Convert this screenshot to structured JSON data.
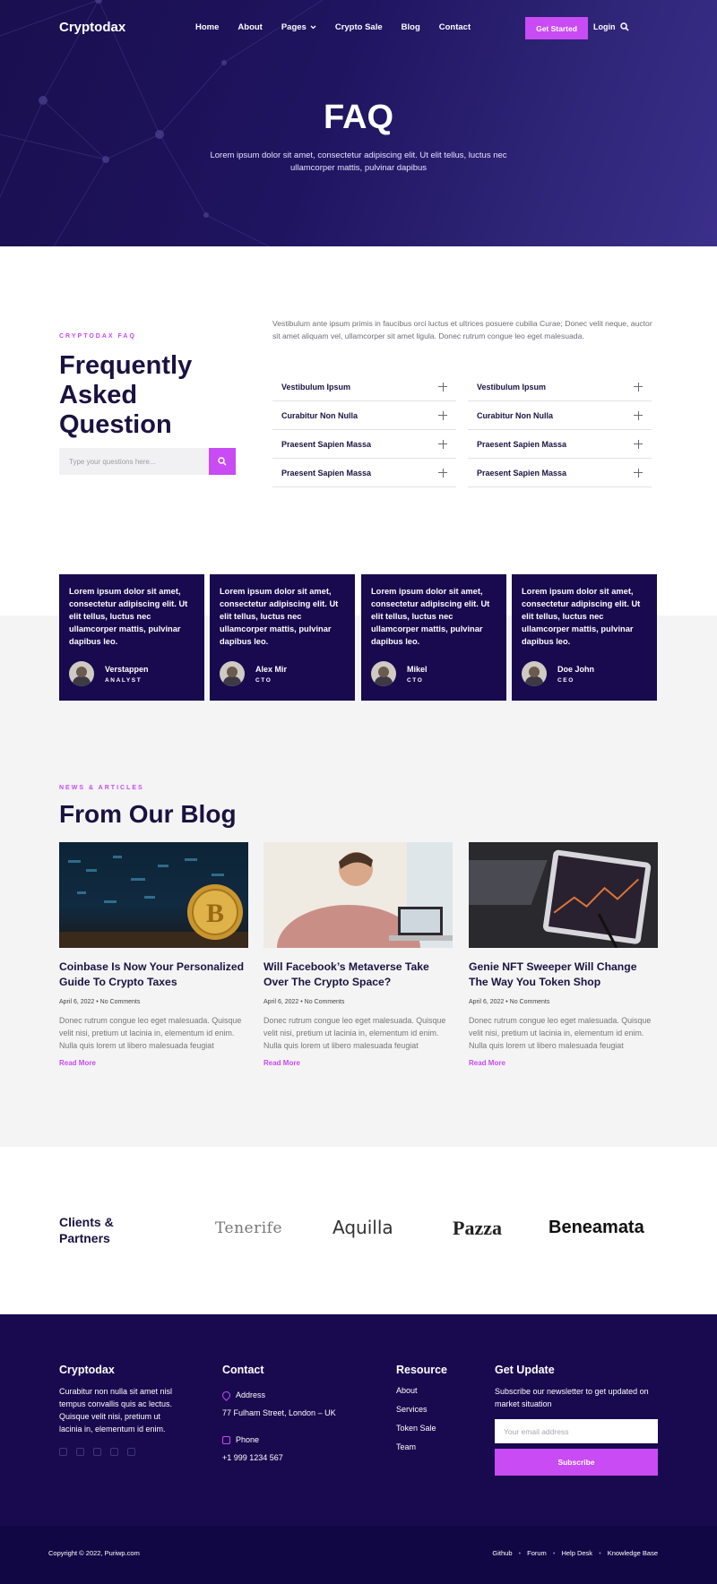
{
  "nav": {
    "logo": "Cryptodax",
    "items": [
      "Home",
      "About",
      "Pages",
      "Crypto Sale",
      "Blog",
      "Contact"
    ],
    "cta": "Get Started",
    "login": "Login"
  },
  "hero": {
    "title": "FAQ",
    "subtitle": "Lorem ipsum dolor sit amet, consectetur adipiscing elit. Ut elit tellus, luctus nec ullamcorper mattis, pulvinar dapibus"
  },
  "faq": {
    "eyebrow": "CRYPTODAX FAQ",
    "title": "Frequently Asked Question",
    "search_placeholder": "Type your questions here...",
    "intro": "Vestibulum ante ipsum primis in faucibus orci luctus et ultrices posuere cubilia Curae; Donec velit neque, auctor sit amet aliquam vel, ullamcorper sit amet ligula. Donec rutrum congue leo eget malesuada.",
    "left": [
      "Vestibulum Ipsum",
      "Curabitur Non Nulla",
      "Praesent Sapien Massa",
      "Praesent Sapien Massa"
    ],
    "right": [
      "Vestibulum Ipsum",
      "Curabitur Non Nulla",
      "Praesent Sapien Massa",
      "Praesent Sapien Massa"
    ]
  },
  "testimonials": [
    {
      "text": "Lorem ipsum dolor sit amet, consectetur adipiscing elit. Ut elit tellus, luctus nec ullamcorper mattis, pulvinar dapibus leo.",
      "name": "Verstappen",
      "role": "ANALYST"
    },
    {
      "text": "Lorem ipsum dolor sit amet, consectetur adipiscing elit. Ut elit tellus, luctus nec ullamcorper mattis, pulvinar dapibus leo.",
      "name": "Alex Mir",
      "role": "CTO"
    },
    {
      "text": "Lorem ipsum dolor sit amet, consectetur adipiscing elit. Ut elit tellus, luctus nec ullamcorper mattis, pulvinar dapibus leo.",
      "name": "Mikel",
      "role": "CTO"
    },
    {
      "text": "Lorem ipsum dolor sit amet, consectetur adipiscing elit. Ut elit tellus, luctus nec ullamcorper mattis, pulvinar dapibus leo.",
      "name": "Doe John",
      "role": "CEO"
    }
  ],
  "blog": {
    "eyebrow": "NEWS & ARTICLES",
    "title": "From Our Blog",
    "posts": [
      {
        "title": "Coinbase Is Now Your Personalized Guide To Crypto Taxes",
        "meta": "April 6, 2022 • No Comments",
        "excerpt": "Donec rutrum congue leo eget malesuada. Quisque velit nisi, pretium ut lacinia in, elementum id enim. Nulla quis lorem ut libero malesuada feugiat",
        "more": "Read More"
      },
      {
        "title": "Will Facebook’s Metaverse Take Over The Crypto Space?",
        "meta": "April 6, 2022 • No Comments",
        "excerpt": "Donec rutrum congue leo eget malesuada. Quisque velit nisi, pretium ut lacinia in, elementum id enim. Nulla quis lorem ut libero malesuada feugiat",
        "more": "Read More"
      },
      {
        "title": "Genie NFT Sweeper Will Change The Way You Token Shop",
        "meta": "April 6, 2022 • No Comments",
        "excerpt": "Donec rutrum congue leo eget malesuada. Quisque velit nisi, pretium ut lacinia in, elementum id enim. Nulla quis lorem ut libero malesuada feugiat",
        "more": "Read More"
      }
    ]
  },
  "clients": {
    "title": "Clients & Partners",
    "logos": [
      "Tenerife",
      "Aquilla",
      "Pazza",
      "Beneamata"
    ]
  },
  "footer": {
    "brand": "Cryptodax",
    "about": "Curabitur non nulla sit amet nisl tempus convallis quis ac lectus. Quisque velit nisi, pretium ut lacinia in, elementum id enim.",
    "contact_title": "Contact",
    "address_label": "Address",
    "address": "77 Fulham Street, London – UK",
    "phone_label": "Phone",
    "phone": "+1 999 1234 567",
    "resource_title": "Resource",
    "resources": [
      "About",
      "Services",
      "Token Sale",
      "Team"
    ],
    "update_title": "Get Update",
    "update_text": "Subscribe our newsletter to get updated on market situation",
    "email_placeholder": "Your email address",
    "subscribe": "Subscribe",
    "copyright": "Copyright © 2022, Puriwp.com",
    "bottom_links": [
      "Github",
      "Forum",
      "Help Desk",
      "Knowledge Base"
    ]
  },
  "colors": {
    "accent": "#c84bf3",
    "navy": "#190a4f"
  }
}
